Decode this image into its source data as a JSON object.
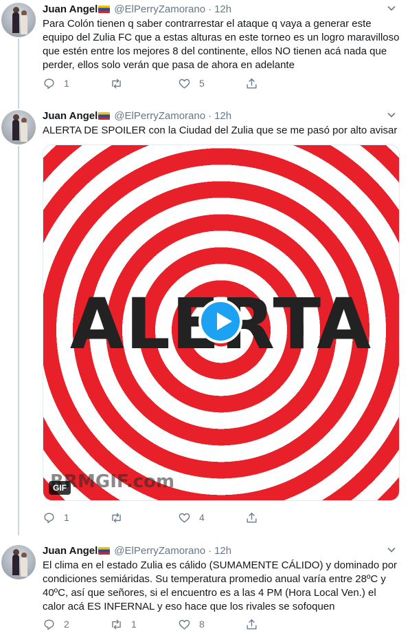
{
  "tweets": [
    {
      "name": "Juan Angel",
      "handle": "@ElPerryZamorano",
      "dot": "·",
      "time": "12h",
      "text": "Para Colón tienen q saber contrarrestar el ataque q vaya a generar este equipo del Zulia FC que a estas alturas en este torneo es un logro maravilloso que estén entre los mejores 8 del continente, ellos NO tienen acá nada que perder, ellos solo verán que pasa de ahora en adelante",
      "replies": "1",
      "retweets": "",
      "likes": "5"
    },
    {
      "name": "Juan Angel",
      "handle": "@ElPerryZamorano",
      "dot": "·",
      "time": "12h",
      "text": "ALERTA DE SPOILER con la Ciudad del Zulia que se me pasó por alto avisar",
      "media": {
        "overlay_text": "ALERTA",
        "watermark": "RRMGIF.com",
        "badge": "GIF"
      },
      "replies": "1",
      "retweets": "",
      "likes": "4"
    },
    {
      "name": "Juan Angel",
      "handle": "@ElPerryZamorano",
      "dot": "·",
      "time": "12h",
      "text": "El clima en el estado Zulia es cálido (SUMAMENTE CÁLIDO) y dominado por condiciones semiáridas. Su temperatura promedio anual varía entre 28ºC y 40ºC, así que señores, si el encuentro es a las 4 PM (Hora Local Ven.) el calor acá ES INFERNAL y eso hace que los rivales se sofoquen",
      "replies": "2",
      "retweets": "1",
      "likes": "8"
    }
  ],
  "icons": {
    "reply": "reply-icon",
    "retweet": "retweet-icon",
    "like": "like-icon",
    "share": "share-icon",
    "menu": "chevron-down-icon",
    "play": "play-icon",
    "flag": "venezuela-flag-icon"
  },
  "colors": {
    "accent": "#1da1f2",
    "muted": "#657786",
    "thread_line": "#ccd6dd",
    "target_red": "#e8202a"
  }
}
